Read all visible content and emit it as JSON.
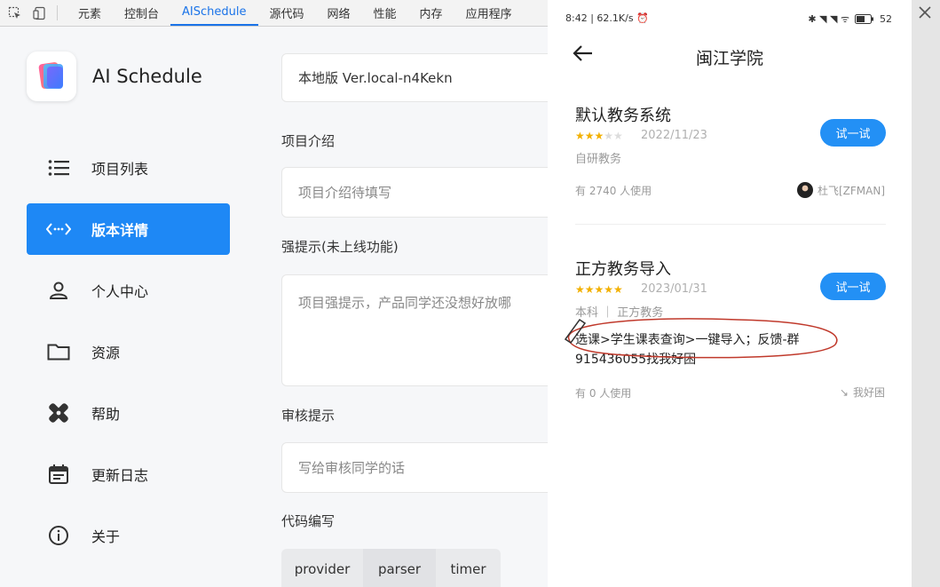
{
  "devtools": {
    "tabs": [
      "元素",
      "控制台",
      "AISchedule",
      "源代码",
      "网络",
      "性能",
      "内存",
      "应用程序"
    ],
    "active_tab": "AISchedule"
  },
  "sidebar": {
    "app_name": "AI Schedule",
    "items": [
      {
        "label": "项目列表",
        "icon": "list-icon"
      },
      {
        "label": "版本详情",
        "icon": "code-icon",
        "active": true
      },
      {
        "label": "个人中心",
        "icon": "person-icon"
      },
      {
        "label": "资源",
        "icon": "folder-icon"
      },
      {
        "label": "帮助",
        "icon": "bandage-icon"
      },
      {
        "label": "更新日志",
        "icon": "calendar-icon"
      },
      {
        "label": "关于",
        "icon": "info-icon"
      }
    ],
    "accent": "#1e88f5"
  },
  "form": {
    "version": "本地版 Ver.local-n4Kekn",
    "intro_label": "项目介绍",
    "intro_placeholder": "项目介绍待填写",
    "strong_label": "强提示(未上线功能)",
    "strong_placeholder": "项目强提示，产品同学还没想好放哪",
    "review_label": "审核提示",
    "review_placeholder": "写给审核同学的话",
    "code_label": "代码编写",
    "code_tabs": [
      "provider",
      "parser",
      "timer"
    ]
  },
  "phone": {
    "status_time": "8:42",
    "status_speed": "62.1K/s",
    "battery": "52",
    "title": "闽江学院",
    "cards": [
      {
        "title": "默认教务系统",
        "rating": 2.5,
        "date": "2022/11/23",
        "sub": "自研教务",
        "button": "试一试",
        "users": "有 2740 人使用",
        "author": "杜飞[ZFMAN]"
      },
      {
        "title": "正方教务导入",
        "rating": 5,
        "date": "2023/01/31",
        "sub": "本科 ｜ 正方教务",
        "button": "试一试",
        "note": "选课>学生课表查询>一键导入；反馈-群915436055找我好困",
        "users": "有 0 人使用",
        "author": "我好困"
      }
    ],
    "accent": "#2390f5"
  }
}
